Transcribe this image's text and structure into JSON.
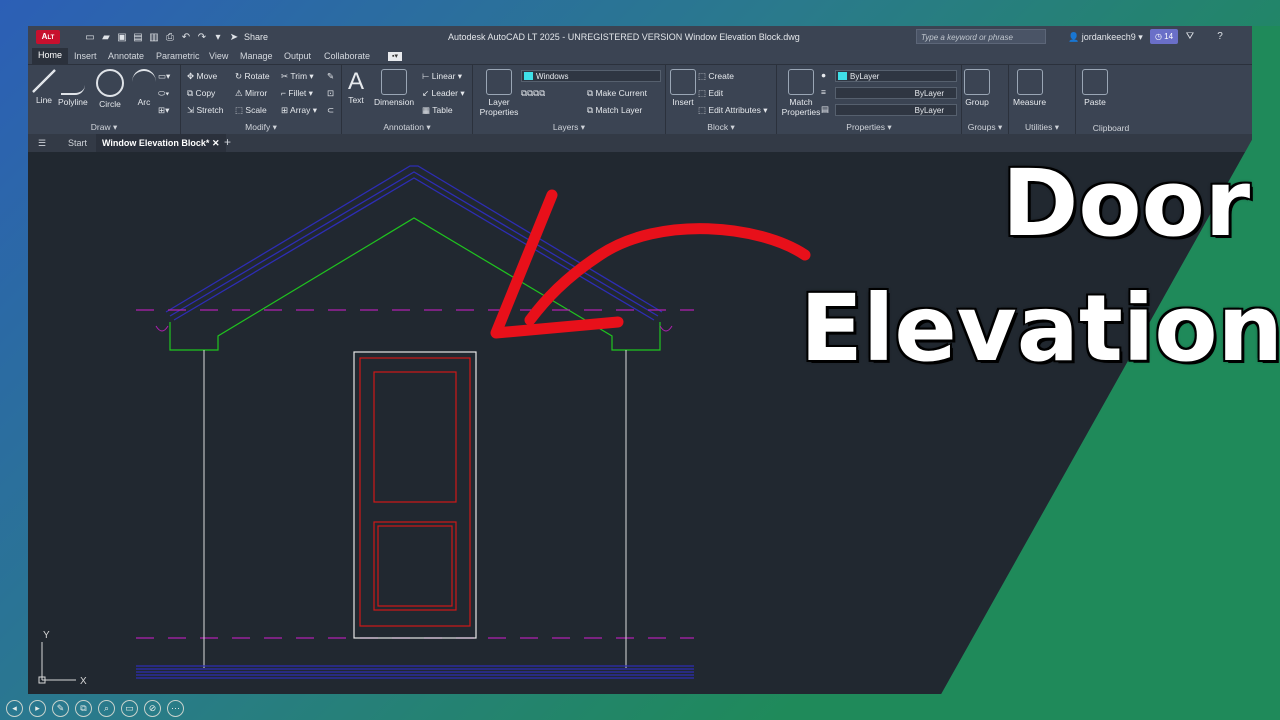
{
  "window": {
    "title": "Autodesk AutoCAD LT 2025 - UNREGISTERED VERSION   Window Elevation Block.dwg",
    "logo": "A",
    "logo_sub": "LT",
    "share_label": "Share",
    "search_placeholder": "Type a keyword or phrase",
    "username": "jordankeech9",
    "badge": "14"
  },
  "ribbon_tabs": [
    "Home",
    "Insert",
    "Annotate",
    "Parametric",
    "View",
    "Manage",
    "Output",
    "Collaborate"
  ],
  "panels": {
    "draw": {
      "title": "Draw",
      "line": "Line",
      "polyline": "Polyline",
      "circle": "Circle",
      "arc": "Arc"
    },
    "modify": {
      "title": "Modify",
      "move": "Move",
      "rotate": "Rotate",
      "trim": "Trim",
      "copy": "Copy",
      "mirror": "Mirror",
      "fillet": "Fillet",
      "stretch": "Stretch",
      "scale": "Scale",
      "array": "Array"
    },
    "annotation": {
      "title": "Annotation",
      "text": "Text",
      "dimension": "Dimension",
      "linear": "Linear",
      "leader": "Leader",
      "table": "Table"
    },
    "layers": {
      "title": "Layers",
      "layer_properties": "Layer Properties",
      "current_layer": "Windows",
      "make_current": "Make Current",
      "match_layer": "Match Layer"
    },
    "block": {
      "title": "Block",
      "insert": "Insert",
      "create": "Create",
      "edit": "Edit",
      "edit_attributes": "Edit Attributes"
    },
    "properties": {
      "title": "Properties",
      "match_properties": "Match Properties",
      "color": "ByLayer",
      "linetype": "ByLayer",
      "lineweight": "ByLayer"
    },
    "groups": {
      "title": "Groups",
      "group": "Group"
    },
    "utilities": {
      "title": "Utilities",
      "measure": "Measure"
    },
    "clipboard": {
      "title": "Clipboard",
      "paste": "Paste"
    }
  },
  "file_tabs": {
    "start": "Start",
    "active": "Window Elevation Block*"
  },
  "ucs": {
    "x": "X",
    "y": "Y"
  },
  "overlay": {
    "line1": "Door",
    "line2": "Elevation"
  },
  "colors": {
    "accent": "#6a6fc8",
    "drawing_bg": "#212830",
    "door": "#d01818",
    "roof": "#2d2db4",
    "trim": "#1fc41f",
    "dash": "#b020b0",
    "arrow": "#e8101a",
    "green_bg": "#1f8a5a"
  }
}
